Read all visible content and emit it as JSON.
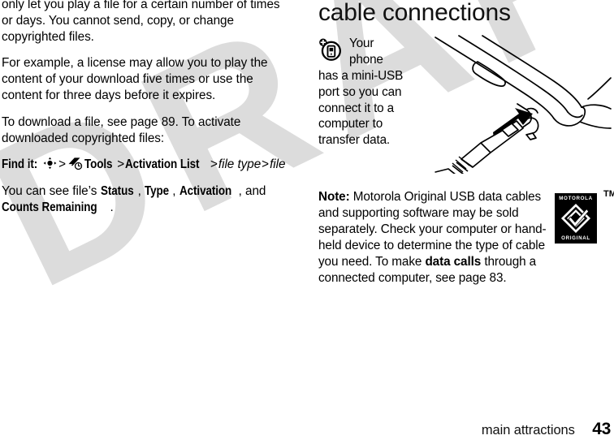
{
  "watermark": {
    "text": "DRAFT",
    "color": "#dcdcdc"
  },
  "left_column": {
    "paragraphs": [
      {
        "id": "drm-limits",
        "text": "only let you play a file for a certain number of times or days. You cannot send, copy, or change copyrighted files."
      },
      {
        "id": "license-example",
        "text": "For example, a license may allow you to play the content of your download five times or use the content for three days before it expires."
      },
      {
        "id": "download-instructions",
        "text": "To download a file, see page 89. To activate downloaded copyrighted files:"
      }
    ],
    "find_it": {
      "label": "Find it:",
      "separator": ">",
      "nav_icon_name": "nav-key-icon",
      "tools_icon_name": "tools-icon",
      "steps": [
        {
          "text": "Tools",
          "style": "condensed-bold"
        },
        {
          "text": "Activation List",
          "style": "condensed-bold"
        },
        {
          "text": "file type",
          "style": "italic"
        },
        {
          "text": "file",
          "style": "italic"
        }
      ]
    },
    "file_properties_note": {
      "prefix": "You can see file’s ",
      "items": [
        "Status",
        "Type",
        "Activation"
      ],
      "conjunction": ", and ",
      "last_item": "Counts Remaining",
      "suffix": "."
    }
  },
  "right_column": {
    "heading": "cable connections",
    "phone_note": {
      "icon_name": "phone-tip-icon",
      "line1": "Your",
      "line2": "phone",
      "rest": "has a mini-USB port so you can connect it to a computer to transfer data."
    },
    "usb_note": {
      "label": "Note:",
      "part1": " Motorola Original USB data cables and supporting software may be sold separately. Check your computer or hand-held device to determine the type of cable you need. To make ",
      "emphasis": "data calls",
      "part2": " through a connected computer, see page 83."
    },
    "illustration": {
      "name": "phone-mini-usb-cable-illustration",
      "alt": "Line drawing of a mobile phone with a mini-USB cable plugging into its port"
    },
    "motorola_badge": {
      "top_word": "MOTOROLA",
      "bottom_word": "ORIGINAL",
      "trademark": "TM",
      "background": "#000000"
    }
  },
  "footer": {
    "section": "main attractions",
    "page_number": "43"
  }
}
